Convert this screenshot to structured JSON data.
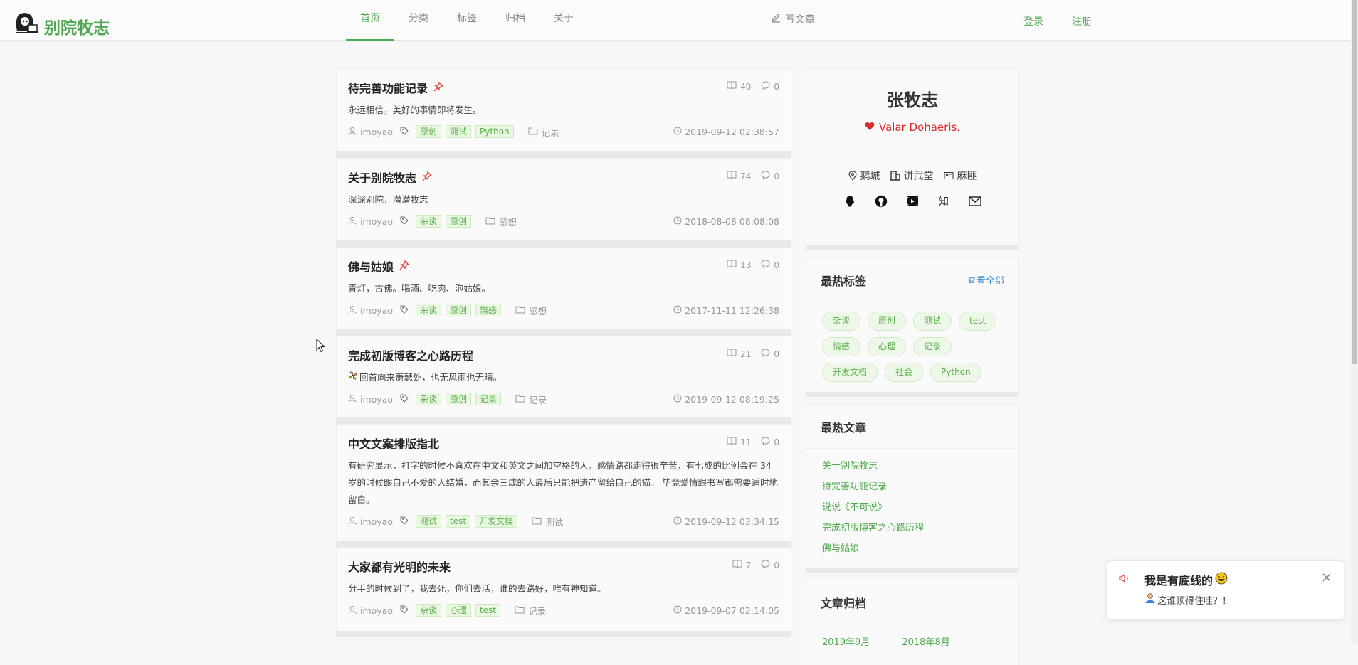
{
  "header": {
    "logo_text": "别院牧志",
    "nav": [
      {
        "label": "首页",
        "active": true
      },
      {
        "label": "分类",
        "active": false
      },
      {
        "label": "标签",
        "active": false
      },
      {
        "label": "归档",
        "active": false
      },
      {
        "label": "关于",
        "active": false
      }
    ],
    "write_label": "写文章",
    "login_label": "登录",
    "register_label": "注册"
  },
  "posts": [
    {
      "title": "待完善功能记录",
      "pinned": true,
      "views": "40",
      "comments": "0",
      "summary": "永远相信，美好的事情即将发生。",
      "author": "imoyao",
      "tags": [
        "原创",
        "测试",
        "Python"
      ],
      "category": "记录",
      "date": "2019-09-12 02:38:57"
    },
    {
      "title": "关于别院牧志",
      "pinned": true,
      "views": "74",
      "comments": "0",
      "summary": "深深别院，潜潜牧志",
      "author": "imoyao",
      "tags": [
        "杂谈",
        "原创"
      ],
      "category": "感想",
      "date": "2018-08-08 08:08:08"
    },
    {
      "title": "佛与姑娘",
      "pinned": true,
      "views": "13",
      "comments": "0",
      "summary": "青灯，古佛。喝酒、吃肉、泡姑娘。",
      "author": "imoyao",
      "tags": [
        "杂谈",
        "原创",
        "情感"
      ],
      "category": "感想",
      "date": "2017-11-11 12:26:38"
    },
    {
      "title": "完成初版博客之心路历程",
      "pinned": false,
      "views": "21",
      "comments": "0",
      "summary": "回首向来萧瑟处，也无风雨也无晴。",
      "author": "imoyao",
      "tags": [
        "杂谈",
        "原创",
        "记录"
      ],
      "category": "记录",
      "date": "2019-09-12 08:19:25"
    },
    {
      "title": "中文文案排版指北",
      "pinned": false,
      "views": "11",
      "comments": "0",
      "summary": "有研究显示，打字的时候不喜欢在中文和英文之间加空格的人，感情路都走得很辛苦，有七成的比例会在 34 岁的时候跟自己不爱的人结婚，而其余三成的人最后只能把遗产留给自己的猫。 毕竟爱情跟书写都需要适时地留白。",
      "author": "imoyao",
      "tags": [
        "测试",
        "test",
        "开发文档"
      ],
      "category": "测试",
      "date": "2019-09-12 03:34:15"
    },
    {
      "title": "大家都有光明的未来",
      "pinned": false,
      "views": "7",
      "comments": "0",
      "summary": "分手的时候到了，我去死，你们去活，谁的去路好，唯有神知道。",
      "author": "imoyao",
      "tags": [
        "杂谈",
        "心理",
        "test"
      ],
      "category": "记录",
      "date": "2019-09-07 02:14:05"
    }
  ],
  "profile": {
    "name": "张牧志",
    "motto": "Valar Dohaeris.",
    "location": "鹅城",
    "school": "讲武堂",
    "job": "麻匪",
    "zhi_label": "知"
  },
  "hot_tags": {
    "title": "最热标签",
    "view_all": "查看全部",
    "tags": [
      "杂谈",
      "原创",
      "测试",
      "test",
      "情感",
      "心理",
      "记录",
      "开发文档",
      "社会",
      "Python"
    ]
  },
  "hot_posts": {
    "title": "最热文章",
    "items": [
      "关于别院牧志",
      "待完善功能记录",
      "说说《不可说》",
      "完成初版博客之心路历程",
      "佛与姑娘"
    ]
  },
  "archive": {
    "title": "文章归档",
    "items": [
      "2019年9月",
      "2018年8月"
    ]
  },
  "toast": {
    "title": "我是有底线的",
    "body": "这谁顶得住哇？！"
  },
  "colors": {
    "accent": "#4fa84f",
    "link": "#3b8ed1",
    "motto": "#d9292b"
  }
}
